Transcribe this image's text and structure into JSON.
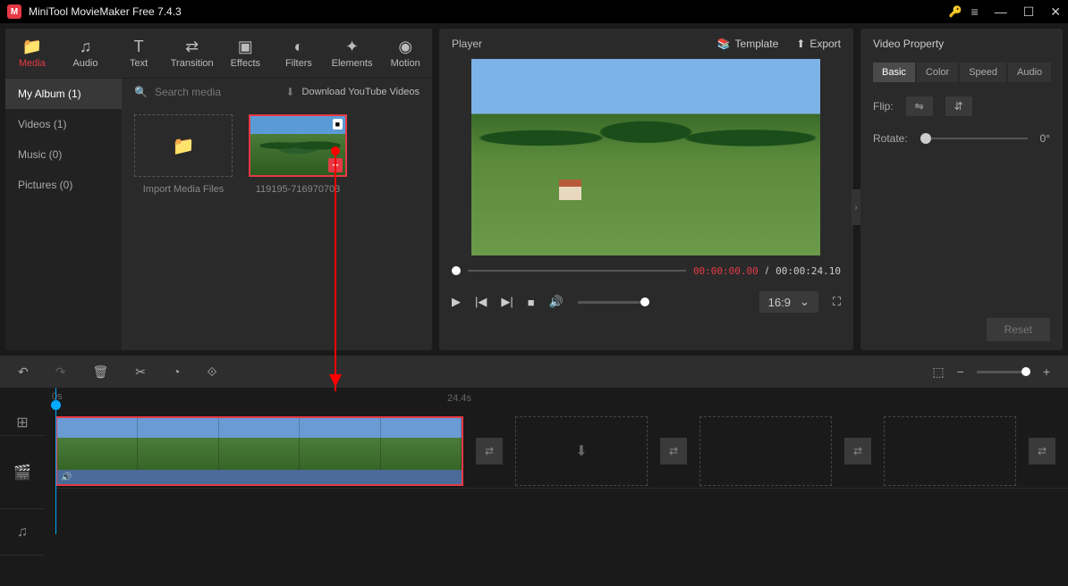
{
  "app": {
    "title": "MiniTool MovieMaker Free 7.4.3"
  },
  "tabs": [
    {
      "label": "Media",
      "icon": "📁"
    },
    {
      "label": "Audio",
      "icon": "♫"
    },
    {
      "label": "Text",
      "icon": "T"
    },
    {
      "label": "Transition",
      "icon": "⇄"
    },
    {
      "label": "Effects",
      "icon": "▣"
    },
    {
      "label": "Filters",
      "icon": "◐"
    },
    {
      "label": "Elements",
      "icon": "✦"
    },
    {
      "label": "Motion",
      "icon": "◉"
    }
  ],
  "sidebar": [
    {
      "label": "My Album (1)"
    },
    {
      "label": "Videos (1)"
    },
    {
      "label": "Music (0)"
    },
    {
      "label": "Pictures (0)"
    }
  ],
  "media": {
    "search_placeholder": "Search media",
    "download_label": "Download YouTube Videos",
    "import_label": "Import Media Files",
    "clip_name": "119195-716970703"
  },
  "player": {
    "title": "Player",
    "template_label": "Template",
    "export_label": "Export",
    "current_time": "00:00:00.00",
    "total_time": "00:00:24.10",
    "ratio": "16:9"
  },
  "props": {
    "title": "Video Property",
    "tabs": [
      "Basic",
      "Color",
      "Speed",
      "Audio"
    ],
    "flip_label": "Flip:",
    "rotate_label": "Rotate:",
    "rotate_value": "0°",
    "reset_label": "Reset"
  },
  "timeline": {
    "zero": "0s",
    "mark": "24.4s"
  }
}
